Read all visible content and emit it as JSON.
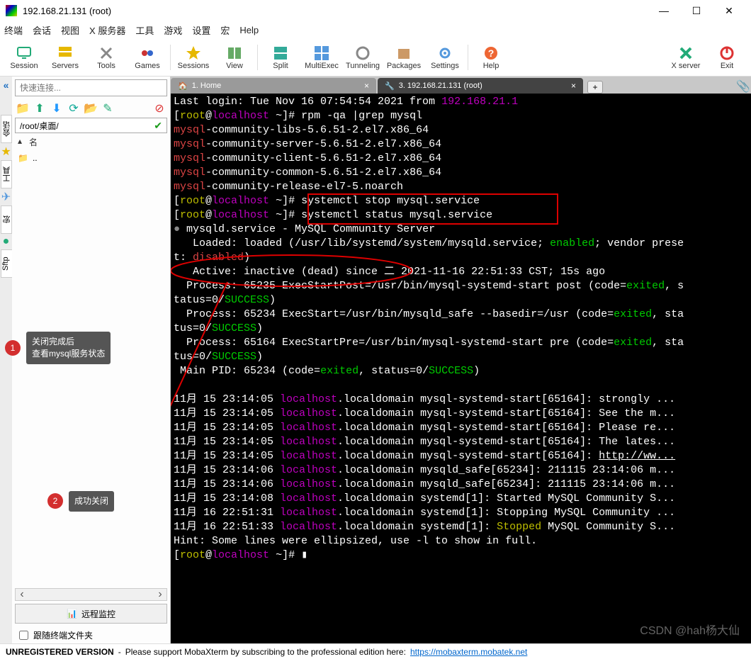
{
  "window": {
    "title": "192.168.21.131 (root)",
    "min": "—",
    "max": "☐",
    "close": "✕"
  },
  "menu": {
    "items": [
      "终端",
      "会话",
      "视图",
      "X 服务器",
      "工具",
      "游戏",
      "设置",
      "宏",
      "Help"
    ]
  },
  "toolbar": {
    "session": "Session",
    "servers": "Servers",
    "tools": "Tools",
    "games": "Games",
    "sessions": "Sessions",
    "view": "View",
    "split": "Split",
    "multiexec": "MultiExec",
    "tunneling": "Tunneling",
    "packages": "Packages",
    "settings": "Settings",
    "help": "Help",
    "xserver": "X server",
    "exit": "Exit"
  },
  "sidebar": {
    "quick_connect_placeholder": "快速连接...",
    "path": "/root/桌面/",
    "columns": {
      "name": "名"
    },
    "entries": [
      ".."
    ],
    "vtabs": [
      "会话",
      "工具",
      "宏",
      "Sftp"
    ],
    "remote_monitor": "远程监控",
    "follow_terminal": "跟随终端文件夹",
    "annotations": {
      "a1_num": "1",
      "a1_text": "关闭完成后\n查看mysql服务状态",
      "a2_num": "2",
      "a2_text": "成功关闭"
    }
  },
  "tabs": {
    "home_label": "1. Home",
    "active_label": "3. 192.168.21.131 (root)",
    "new": "+"
  },
  "terminal": {
    "lastlogin_pre": "Last login: Tue Nov 16 07:54:54 2021 from ",
    "lastlogin_ip": "192.168.21.1",
    "prompt_user": "root",
    "prompt_at": "@",
    "prompt_host": "localhost",
    "prompt_tail": " ~]# ",
    "cmd1": "rpm -qa |grep mysql",
    "pkg1_pre": "mysql",
    "pkg1_rest": "-community-libs-5.6.51-2.el7.x86_64",
    "pkg2_pre": "mysql",
    "pkg2_rest": "-community-server-5.6.51-2.el7.x86_64",
    "pkg3_pre": "mysql",
    "pkg3_rest": "-community-client-5.6.51-2.el7.x86_64",
    "pkg4_pre": "mysql",
    "pkg4_rest": "-community-common-5.6.51-2.el7.x86_64",
    "pkg5_pre": "mysql",
    "pkg5_rest": "-community-release-el7-5.noarch",
    "cmd2": "systemctl stop mysql.service",
    "cmd3": "systemctl status mysql.service",
    "svc_line": " mysqld.service - MySQL Community Server",
    "loaded_pre": "   Loaded: loaded (/usr/lib/systemd/system/mysqld.service; ",
    "enabled": "enabled",
    "loaded_post": "; vendor prese",
    "loaded_wrap_pre": "t: ",
    "disabled": "disabled",
    "loaded_wrap_post": ")",
    "active_line": "   Active: inactive (dead) since 二 2021-11-16 22:51:33 CST; 15s ago",
    "proc1_pre": "  Process: 65235 ExecStartPost=/usr/bin/mysql-systemd-start post (code=",
    "exited": "exited",
    "proc1_mid": ", s",
    "proc1_wrap_pre": "tatus=0/",
    "success": "SUCCESS",
    "proc1_wrap_post": ")",
    "proc2_pre": "  Process: 65234 ExecStart=/usr/bin/mysqld_safe --basedir=/usr (code=",
    "proc2_mid": ", sta",
    "proc2_wrap_pre": "tus=0/",
    "proc2_wrap_post": ")",
    "proc3_pre": "  Process: 65164 ExecStartPre=/usr/bin/mysql-systemd-start pre (code=",
    "proc3_mid": ", sta",
    "proc3_wrap_pre": "tus=0/",
    "proc3_wrap_post": ")",
    "mainpid_pre": " Main PID: 65234 (code=",
    "mainpid_mid": ", status=0/",
    "mainpid_post": ")",
    "log": [
      {
        "date": "11月 15 23:14:05 ",
        "host": "localhost",
        "rest": ".localdomain mysql-systemd-start[65164]: strongly ..."
      },
      {
        "date": "11月 15 23:14:05 ",
        "host": "localhost",
        "rest": ".localdomain mysql-systemd-start[65164]: See the m..."
      },
      {
        "date": "11月 15 23:14:05 ",
        "host": "localhost",
        "rest": ".localdomain mysql-systemd-start[65164]: Please re..."
      },
      {
        "date": "11月 15 23:14:05 ",
        "host": "localhost",
        "rest": ".localdomain mysql-systemd-start[65164]: The lates..."
      },
      {
        "date": "11月 15 23:14:05 ",
        "host": "localhost",
        "rest": ".localdomain mysql-systemd-start[65164]: ",
        "link": "http://ww..."
      },
      {
        "date": "11月 15 23:14:06 ",
        "host": "localhost",
        "rest": ".localdomain mysqld_safe[65234]: 211115 23:14:06 m..."
      },
      {
        "date": "11月 15 23:14:06 ",
        "host": "localhost",
        "rest": ".localdomain mysqld_safe[65234]: 211115 23:14:06 m..."
      },
      {
        "date": "11月 15 23:14:08 ",
        "host": "localhost",
        "rest": ".localdomain systemd[1]: Started MySQL Community S..."
      },
      {
        "date": "11月 16 22:51:31 ",
        "host": "localhost",
        "rest": ".localdomain systemd[1]: Stopping MySQL Community ..."
      },
      {
        "date": "11月 16 22:51:33 ",
        "host": "localhost",
        "rest": ".localdomain systemd[1]: ",
        "stopped": "Stopped",
        "rest2": " MySQL Community S..."
      }
    ],
    "hint": "Hint: Some lines were ellipsized, use -l to show in full.",
    "cursor": "▮"
  },
  "statusbar": {
    "unreg": "UNREGISTERED VERSION",
    "dash": "  -  ",
    "text": "Please support MobaXterm by subscribing to the professional edition here:  ",
    "link": "https://mobaxterm.mobatek.net"
  },
  "watermark": "CSDN @hah杨大仙"
}
